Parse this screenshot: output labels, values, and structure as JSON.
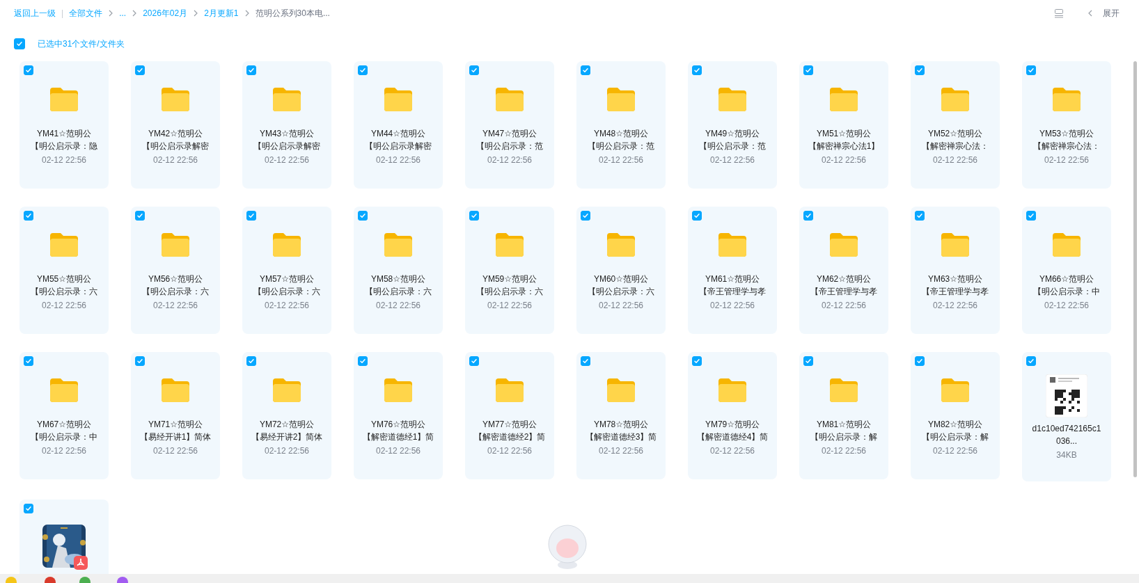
{
  "breadcrumb": {
    "back": "返回上一级",
    "divider": "|",
    "path": [
      {
        "label": "全部文件",
        "current": false
      },
      {
        "label": "...",
        "current": false
      },
      {
        "label": "2026年02月",
        "current": false
      },
      {
        "label": "2月更新1",
        "current": false
      },
      {
        "label": "范明公系列30本电...",
        "current": true
      }
    ]
  },
  "toolbar": {
    "expand": "展开"
  },
  "selection": {
    "checked": true,
    "label": "已选中31个文件/文件夹"
  },
  "items": [
    {
      "kind": "folder",
      "checked": true,
      "title": "YM41☆范明公",
      "title_line_2": "【明公启示录：隐",
      "date": "02-12 22:56"
    },
    {
      "kind": "folder",
      "checked": true,
      "title": "YM42☆范明公",
      "title_line_2": "【明公启示录解密",
      "date": "02-12 22:56"
    },
    {
      "kind": "folder",
      "checked": true,
      "title": "YM43☆范明公",
      "title_line_2": "【明公启示录解密",
      "date": "02-12 22:56"
    },
    {
      "kind": "folder",
      "checked": true,
      "title": "YM44☆范明公",
      "title_line_2": "【明公启示录解密",
      "date": "02-12 22:56"
    },
    {
      "kind": "folder",
      "checked": true,
      "title": "YM47☆范明公",
      "title_line_2": "【明公启示录：范",
      "date": "02-12 22:56"
    },
    {
      "kind": "folder",
      "checked": true,
      "title": "YM48☆范明公",
      "title_line_2": "【明公启示录：范",
      "date": "02-12 22:56"
    },
    {
      "kind": "folder",
      "checked": true,
      "title": "YM49☆范明公",
      "title_line_2": "【明公启示录：范",
      "date": "02-12 22:56"
    },
    {
      "kind": "folder",
      "checked": true,
      "title": "YM51☆范明公",
      "title_line_2": "【解密禅宗心法1】",
      "date": "02-12 22:56"
    },
    {
      "kind": "folder",
      "checked": true,
      "title": "YM52☆范明公",
      "title_line_2": "【解密禅宗心法：",
      "date": "02-12 22:56"
    },
    {
      "kind": "folder",
      "checked": true,
      "title": "YM53☆范明公",
      "title_line_2": "【解密禅宗心法：",
      "date": "02-12 22:56"
    },
    {
      "kind": "folder",
      "checked": true,
      "title": "YM55☆范明公",
      "title_line_2": "【明公启示录：六",
      "date": "02-12 22:56"
    },
    {
      "kind": "folder",
      "checked": true,
      "title": "YM56☆范明公",
      "title_line_2": "【明公启示录：六",
      "date": "02-12 22:56"
    },
    {
      "kind": "folder",
      "checked": true,
      "title": "YM57☆范明公",
      "title_line_2": "【明公启示录：六",
      "date": "02-12 22:56"
    },
    {
      "kind": "folder",
      "checked": true,
      "title": "YM58☆范明公",
      "title_line_2": "【明公启示录：六",
      "date": "02-12 22:56"
    },
    {
      "kind": "folder",
      "checked": true,
      "title": "YM59☆范明公",
      "title_line_2": "【明公启示录：六",
      "date": "02-12 22:56"
    },
    {
      "kind": "folder",
      "checked": true,
      "title": "YM60☆范明公",
      "title_line_2": "【明公启示录：六",
      "date": "02-12 22:56"
    },
    {
      "kind": "folder",
      "checked": true,
      "title": "YM61☆范明公",
      "title_line_2": "【帝王管理学与孝",
      "date": "02-12 22:56"
    },
    {
      "kind": "folder",
      "checked": true,
      "title": "YM62☆范明公",
      "title_line_2": "【帝王管理学与孝",
      "date": "02-12 22:56"
    },
    {
      "kind": "folder",
      "checked": true,
      "title": "YM63☆范明公",
      "title_line_2": "【帝王管理学与孝",
      "date": "02-12 22:56"
    },
    {
      "kind": "folder",
      "checked": true,
      "title": "YM66☆范明公",
      "title_line_2": "【明公启示录：中",
      "date": "02-12 22:56"
    },
    {
      "kind": "folder",
      "checked": true,
      "title": "YM67☆范明公",
      "title_line_2": "【明公启示录：中",
      "date": "02-12 22:56"
    },
    {
      "kind": "folder",
      "checked": true,
      "title": "YM71☆范明公",
      "title_line_2": "【易经开讲1】简体",
      "date": "02-12 22:56"
    },
    {
      "kind": "folder",
      "checked": true,
      "title": "YM72☆范明公",
      "title_line_2": "【易经开讲2】简体",
      "date": "02-12 22:56"
    },
    {
      "kind": "folder",
      "checked": true,
      "title": "YM76☆范明公",
      "title_line_2": "【解密道德经1】简",
      "date": "02-12 22:56"
    },
    {
      "kind": "folder",
      "checked": true,
      "title": "YM77☆范明公",
      "title_line_2": "【解密道德经2】简",
      "date": "02-12 22:56"
    },
    {
      "kind": "folder",
      "checked": true,
      "title": "YM78☆范明公",
      "title_line_2": "【解密道德经3】简",
      "date": "02-12 22:56"
    },
    {
      "kind": "folder",
      "checked": true,
      "title": "YM79☆范明公",
      "title_line_2": "【解密道德经4】简",
      "date": "02-12 22:56"
    },
    {
      "kind": "folder",
      "checked": true,
      "title": "YM81☆范明公",
      "title_line_2": "【明公启示录：解",
      "date": "02-12 22:56"
    },
    {
      "kind": "folder",
      "checked": true,
      "title": "YM82☆范明公",
      "title_line_2": "【明公启示录：解",
      "date": "02-12 22:56"
    },
    {
      "checked": true,
      "title": "d1c10ed742165c1036...",
      "size": "34KB"
    },
    {
      "kind": "pdf",
      "checked": true
    }
  ]
}
